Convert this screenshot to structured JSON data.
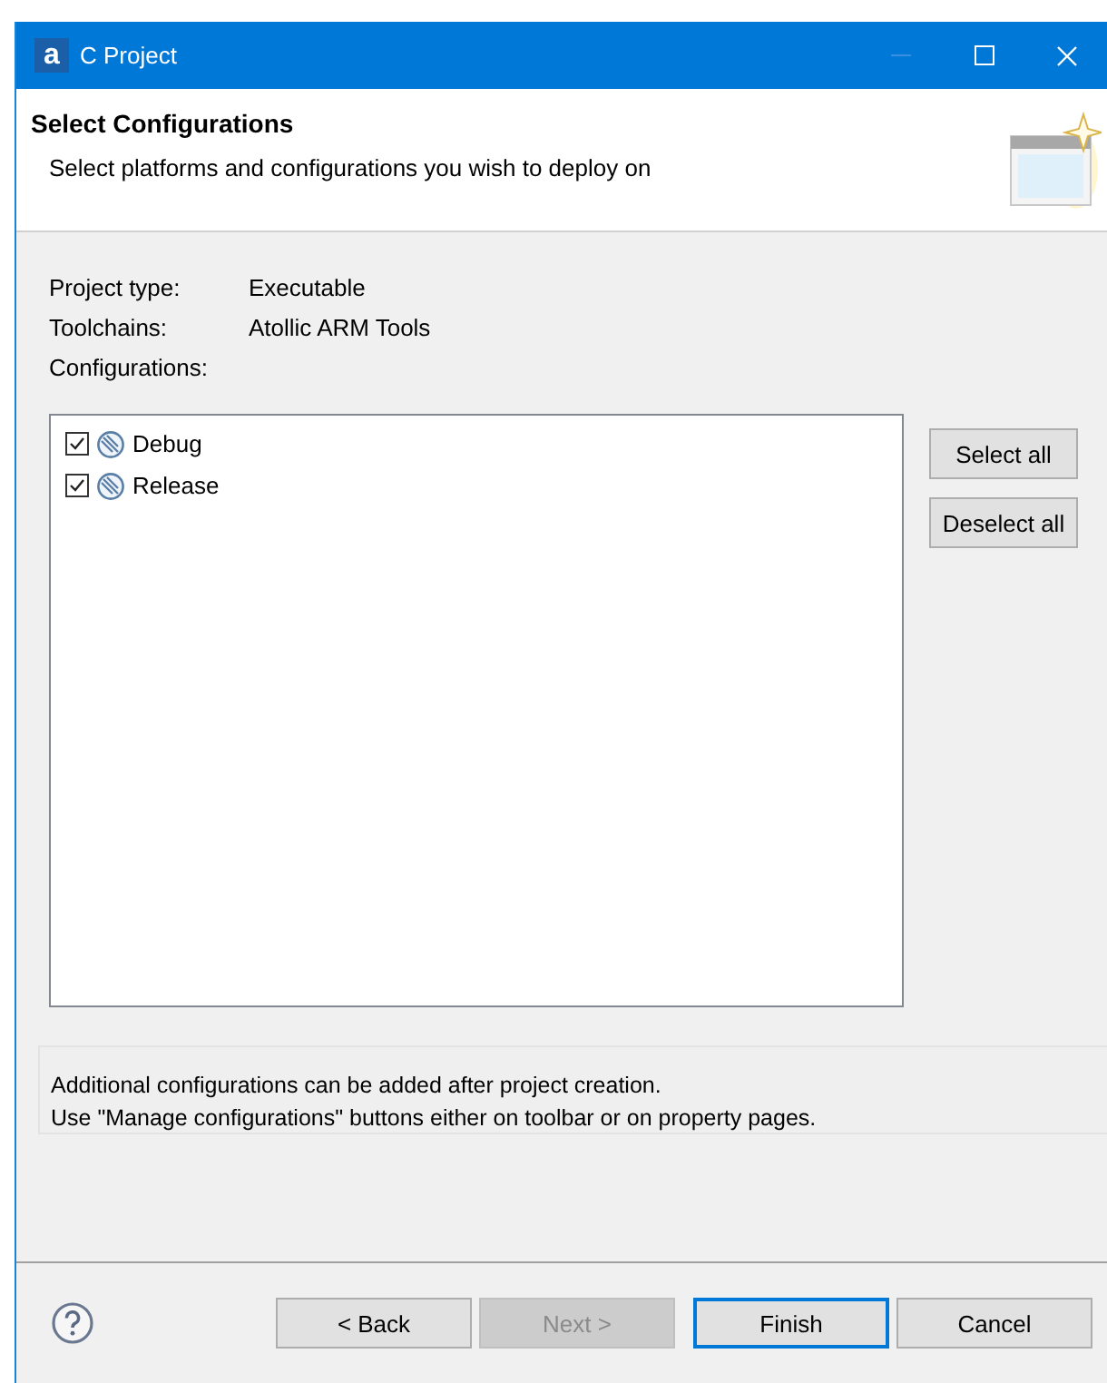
{
  "window": {
    "title": "C Project",
    "app_icon": "a"
  },
  "header": {
    "title": "Select Configurations",
    "subtitle": "Select platforms and configurations you wish to deploy on"
  },
  "info": [
    {
      "label": "Project type:",
      "value": "Executable"
    },
    {
      "label": "Toolchains:",
      "value": "Atollic ARM Tools"
    },
    {
      "label": "Configurations:"
    }
  ],
  "configurations": [
    {
      "name": "Debug",
      "checked": true
    },
    {
      "name": "Release",
      "checked": true
    }
  ],
  "side_buttons": [
    "Select all",
    "Deselect all"
  ],
  "note": [
    "Additional configurations can be added after project creation.",
    "Use \"Manage configurations\" buttons either on toolbar or on property pages."
  ],
  "footer_buttons": [
    {
      "label": "< Back",
      "disabled": false,
      "default": false
    },
    {
      "label": "Next >",
      "disabled": true,
      "default": false
    },
    {
      "label": "Finish",
      "disabled": false,
      "default": true
    },
    {
      "label": "Cancel",
      "disabled": false,
      "default": false
    }
  ]
}
